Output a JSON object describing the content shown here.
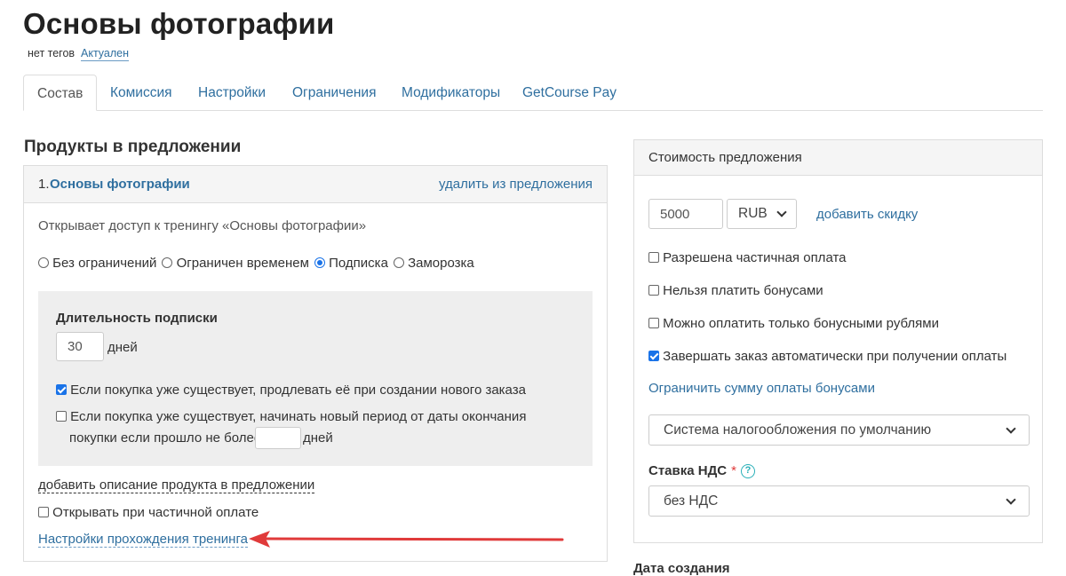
{
  "page": {
    "title": "Основы фотографии",
    "tags_text": "нет тегов",
    "status_link": "Актуален"
  },
  "tabs": [
    {
      "label": "Состав",
      "active": true
    },
    {
      "label": "Комиссия"
    },
    {
      "label": "Настройки"
    },
    {
      "label": "Ограничения"
    },
    {
      "label": "Модификаторы"
    },
    {
      "label": "GetCourse Pay"
    }
  ],
  "products": {
    "heading": "Продукты в предложении",
    "item": {
      "number": "1.",
      "name": "Основы фотографии",
      "remove_link": "удалить из предложения",
      "description": "Открывает доступ к тренингу «Основы фотографии»",
      "access_options": [
        {
          "label": "Без ограничений",
          "checked": false
        },
        {
          "label": "Ограничен временем",
          "checked": false
        },
        {
          "label": "Подписка",
          "checked": true
        },
        {
          "label": "Заморозка",
          "checked": false
        }
      ],
      "subscription": {
        "heading": "Длительность подписки",
        "duration_value": "30",
        "duration_unit": "дней",
        "extend_label": "Если покупка уже существует, продлевать её при создании нового заказа",
        "extend_checked": true,
        "new_period_label_line1": "Если покупка уже существует, начинать новый период от даты окончания",
        "new_period_label_line2": "покупки если прошло не более",
        "new_period_value": "",
        "new_period_unit": "дней",
        "new_period_checked": false
      },
      "add_description_link": "добавить описание продукта в предложении",
      "open_on_partial_label": "Открывать при частичной оплате",
      "open_on_partial_checked": false,
      "training_settings_link": "Настройки прохождения тренинга"
    }
  },
  "pricing": {
    "heading": "Стоимость предложения",
    "price_value": "5000",
    "currency": "RUB",
    "add_discount_link": "добавить скидку",
    "options": [
      {
        "label": "Разрешена частичная оплата",
        "checked": false
      },
      {
        "label": "Нельзя платить бонусами",
        "checked": false
      },
      {
        "label": "Можно оплатить только бонусными рублями",
        "checked": false
      },
      {
        "label": "Завершать заказ автоматически при получении оплаты",
        "checked": true
      }
    ],
    "limit_bonus_link": "Ограничить сумму оплаты бонусами",
    "tax_system": "Система налогообложения по умолчанию",
    "vat_label": "Ставка НДС",
    "vat_required_mark": "*",
    "help_icon_glyph": "?",
    "vat_value": "без НДС"
  },
  "created": {
    "heading": "Дата создания"
  },
  "annotation": {
    "arrow_color": "#e03a3a"
  },
  "colors": {
    "link": "#2f6f9f",
    "checkbox_accent": "#1a73e8",
    "help_icon": "#2ab0b8"
  }
}
